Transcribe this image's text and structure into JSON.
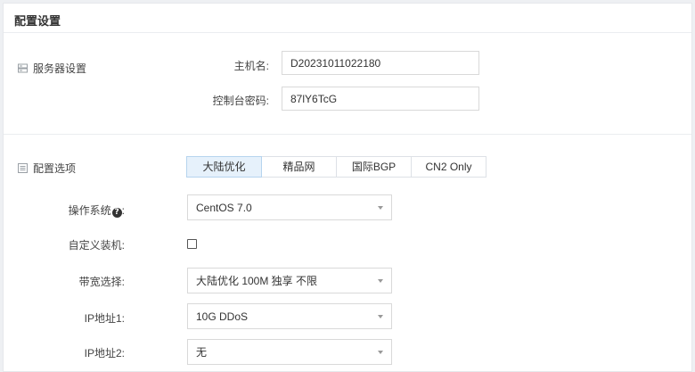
{
  "header": {
    "title": "配置设置"
  },
  "server_section": {
    "label": "服务器设置",
    "hostname": {
      "label": "主机名:",
      "value": "D20231011022180"
    },
    "password": {
      "label": "控制台密码:",
      "value": "87lY6TcG"
    }
  },
  "config_section": {
    "label": "配置选项",
    "tabs": [
      {
        "label": "大陆优化",
        "active": true
      },
      {
        "label": "精品网",
        "active": false
      },
      {
        "label": "国际BGP",
        "active": false
      },
      {
        "label": "CN2 Only",
        "active": false
      }
    ],
    "os": {
      "label": "操作系统",
      "label_suffix": ":",
      "value": "CentOS 7.0"
    },
    "custom_install": {
      "label": "自定义装机:",
      "checked": false
    },
    "bandwidth": {
      "label": "带宽选择:",
      "value": "大陆优化 100M 独享 不限"
    },
    "ip1": {
      "label": "IP地址1:",
      "value": "10G DDoS"
    },
    "ip2": {
      "label": "IP地址2:",
      "value": "无"
    }
  },
  "colors": {
    "active_tab_bg": "#e6f1fb",
    "border": "#d9d9d9"
  }
}
